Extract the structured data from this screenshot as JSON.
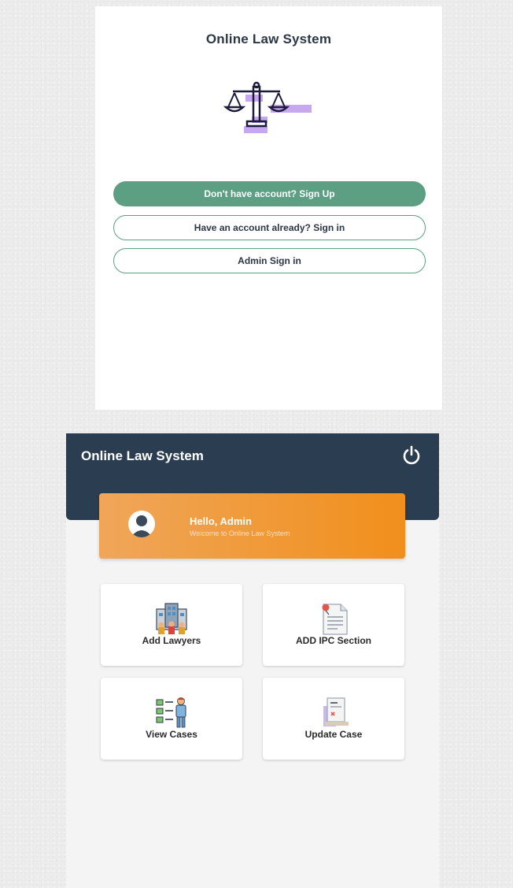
{
  "welcome_screen": {
    "title": "Online Law System",
    "logo_icon": "scales-of-justice-icon",
    "signup_button": "Don't have account? Sign Up",
    "signin_button": "Have an account already? Sign in",
    "admin_button": "Admin Sign in",
    "accent_color": "#5c9f83"
  },
  "admin_dashboard": {
    "header": {
      "title": "Online Law System",
      "power_icon": "power-icon",
      "color": "#2b3d50"
    },
    "welcome_card": {
      "greeting": "Hello, Admin",
      "subtitle": "Welcome to Online Law System",
      "avatar_icon": "user-avatar-icon",
      "color": "#f18f1b"
    },
    "tiles": [
      {
        "label": "Add Lawyers",
        "icon": "lawyers-building-icon"
      },
      {
        "label": "ADD IPC Section",
        "icon": "document-pin-icon"
      },
      {
        "label": "View Cases",
        "icon": "checklist-person-icon"
      },
      {
        "label": "Update Case",
        "icon": "case-file-icon"
      }
    ]
  }
}
